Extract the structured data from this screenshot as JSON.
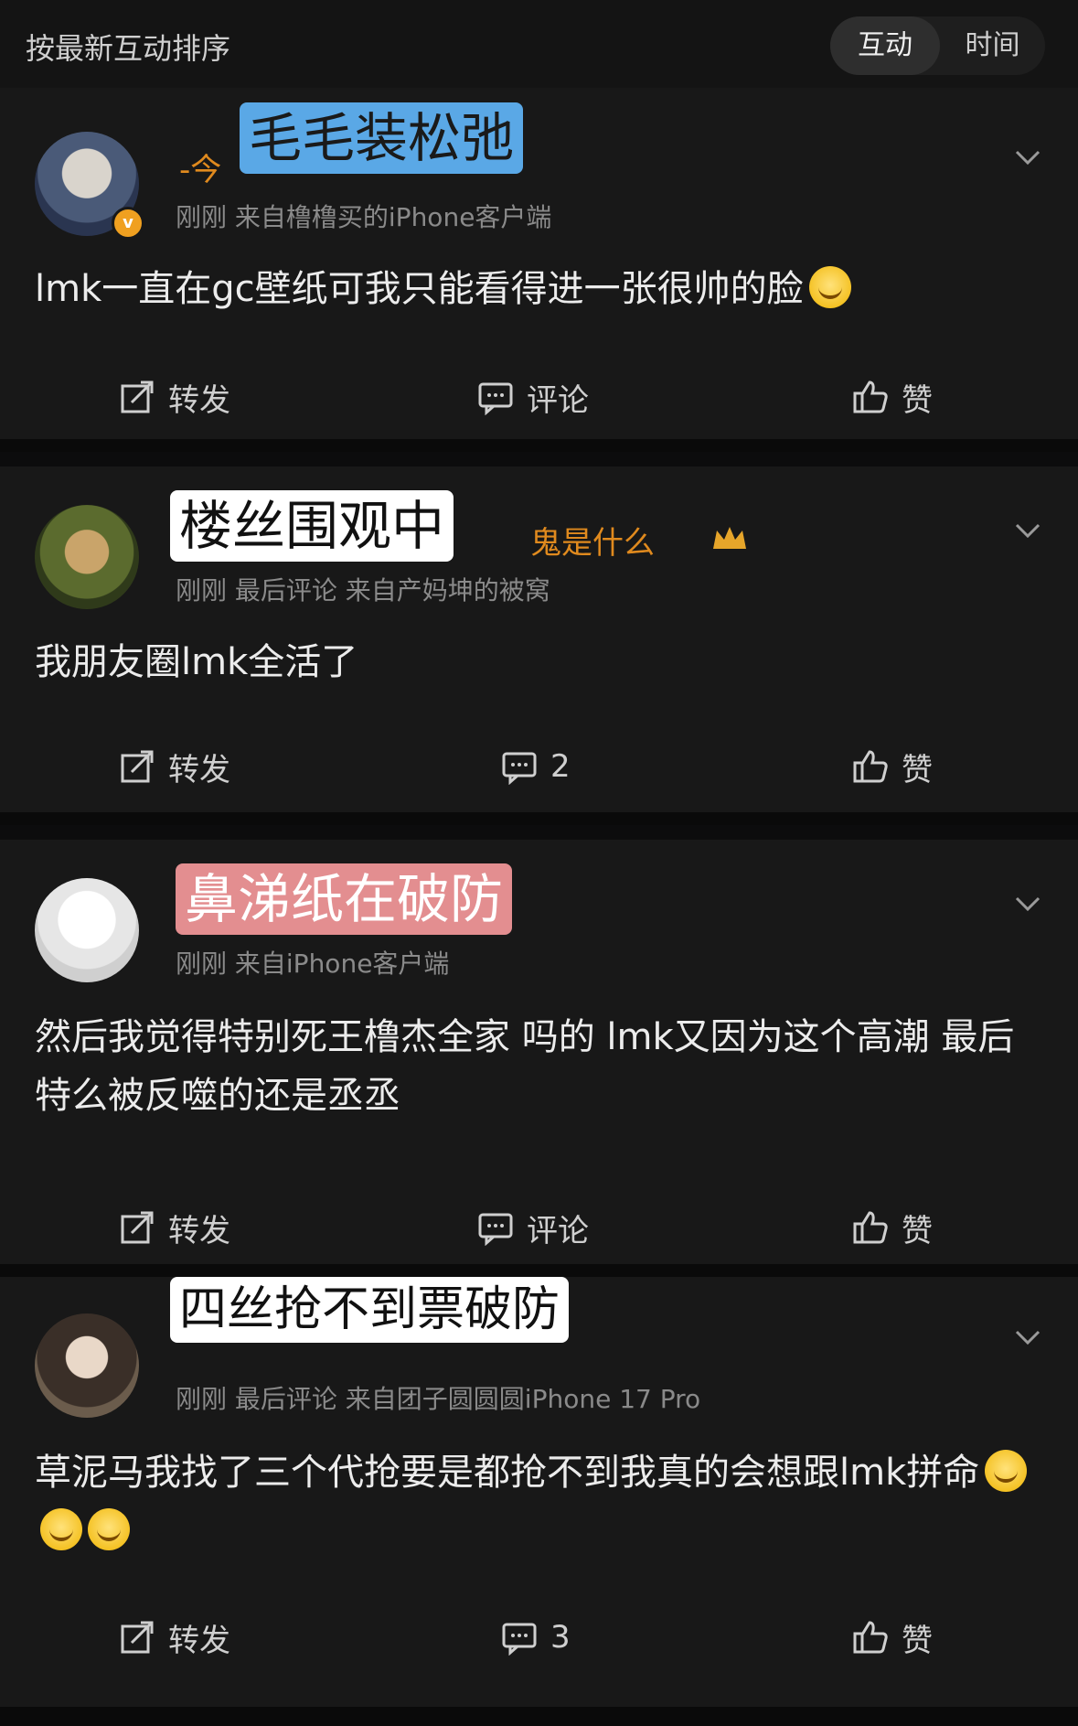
{
  "header": {
    "sort_label": "按最新互动排序",
    "tabs": [
      "互动",
      "时间"
    ]
  },
  "colors": {
    "background": "#0c0c0d",
    "card": "#181818",
    "username": "#e08a1e",
    "meta_text": "#8a8a8a",
    "sticker_blue": "#5aa8e6",
    "sticker_pink": "#e38e90"
  },
  "posts": [
    {
      "name_partial": "-今",
      "meta": "刚刚   来自橹橹买的iPhone客户端",
      "text": "lmk一直在gc壁纸可我只能看得进一张很帅的脸",
      "sticker": "毛毛装松弛",
      "actions": {
        "repost": "转发",
        "comment": "评论",
        "like": "赞"
      }
    },
    {
      "name_partial": "鬼是什么",
      "meta": "刚刚  最后评论  来自产妈坤的被窝",
      "text": "我朋友圈lmk全活了",
      "sticker": "楼丝围观中",
      "actions": {
        "repost": "转发",
        "comment": "2",
        "like": "赞"
      }
    },
    {
      "meta": "刚刚   来自iPhone客户端",
      "text": "然后我觉得特别死王橹杰全家 吗的 lmk又因为这个高潮 最后特么被反噬的还是丞丞",
      "sticker": "鼻涕纸在破防",
      "actions": {
        "repost": "转发",
        "comment": "评论",
        "like": "赞"
      }
    },
    {
      "meta": "刚刚 最后评论  来自团子圆圆圆iPhone 17 Pro",
      "text": "草泥马我找了三个代抢要是都抢不到我真的会想跟lmk拼命",
      "sticker": "四丝抢不到票破防",
      "actions": {
        "repost": "转发",
        "comment": "3",
        "like": "赞"
      }
    }
  ]
}
